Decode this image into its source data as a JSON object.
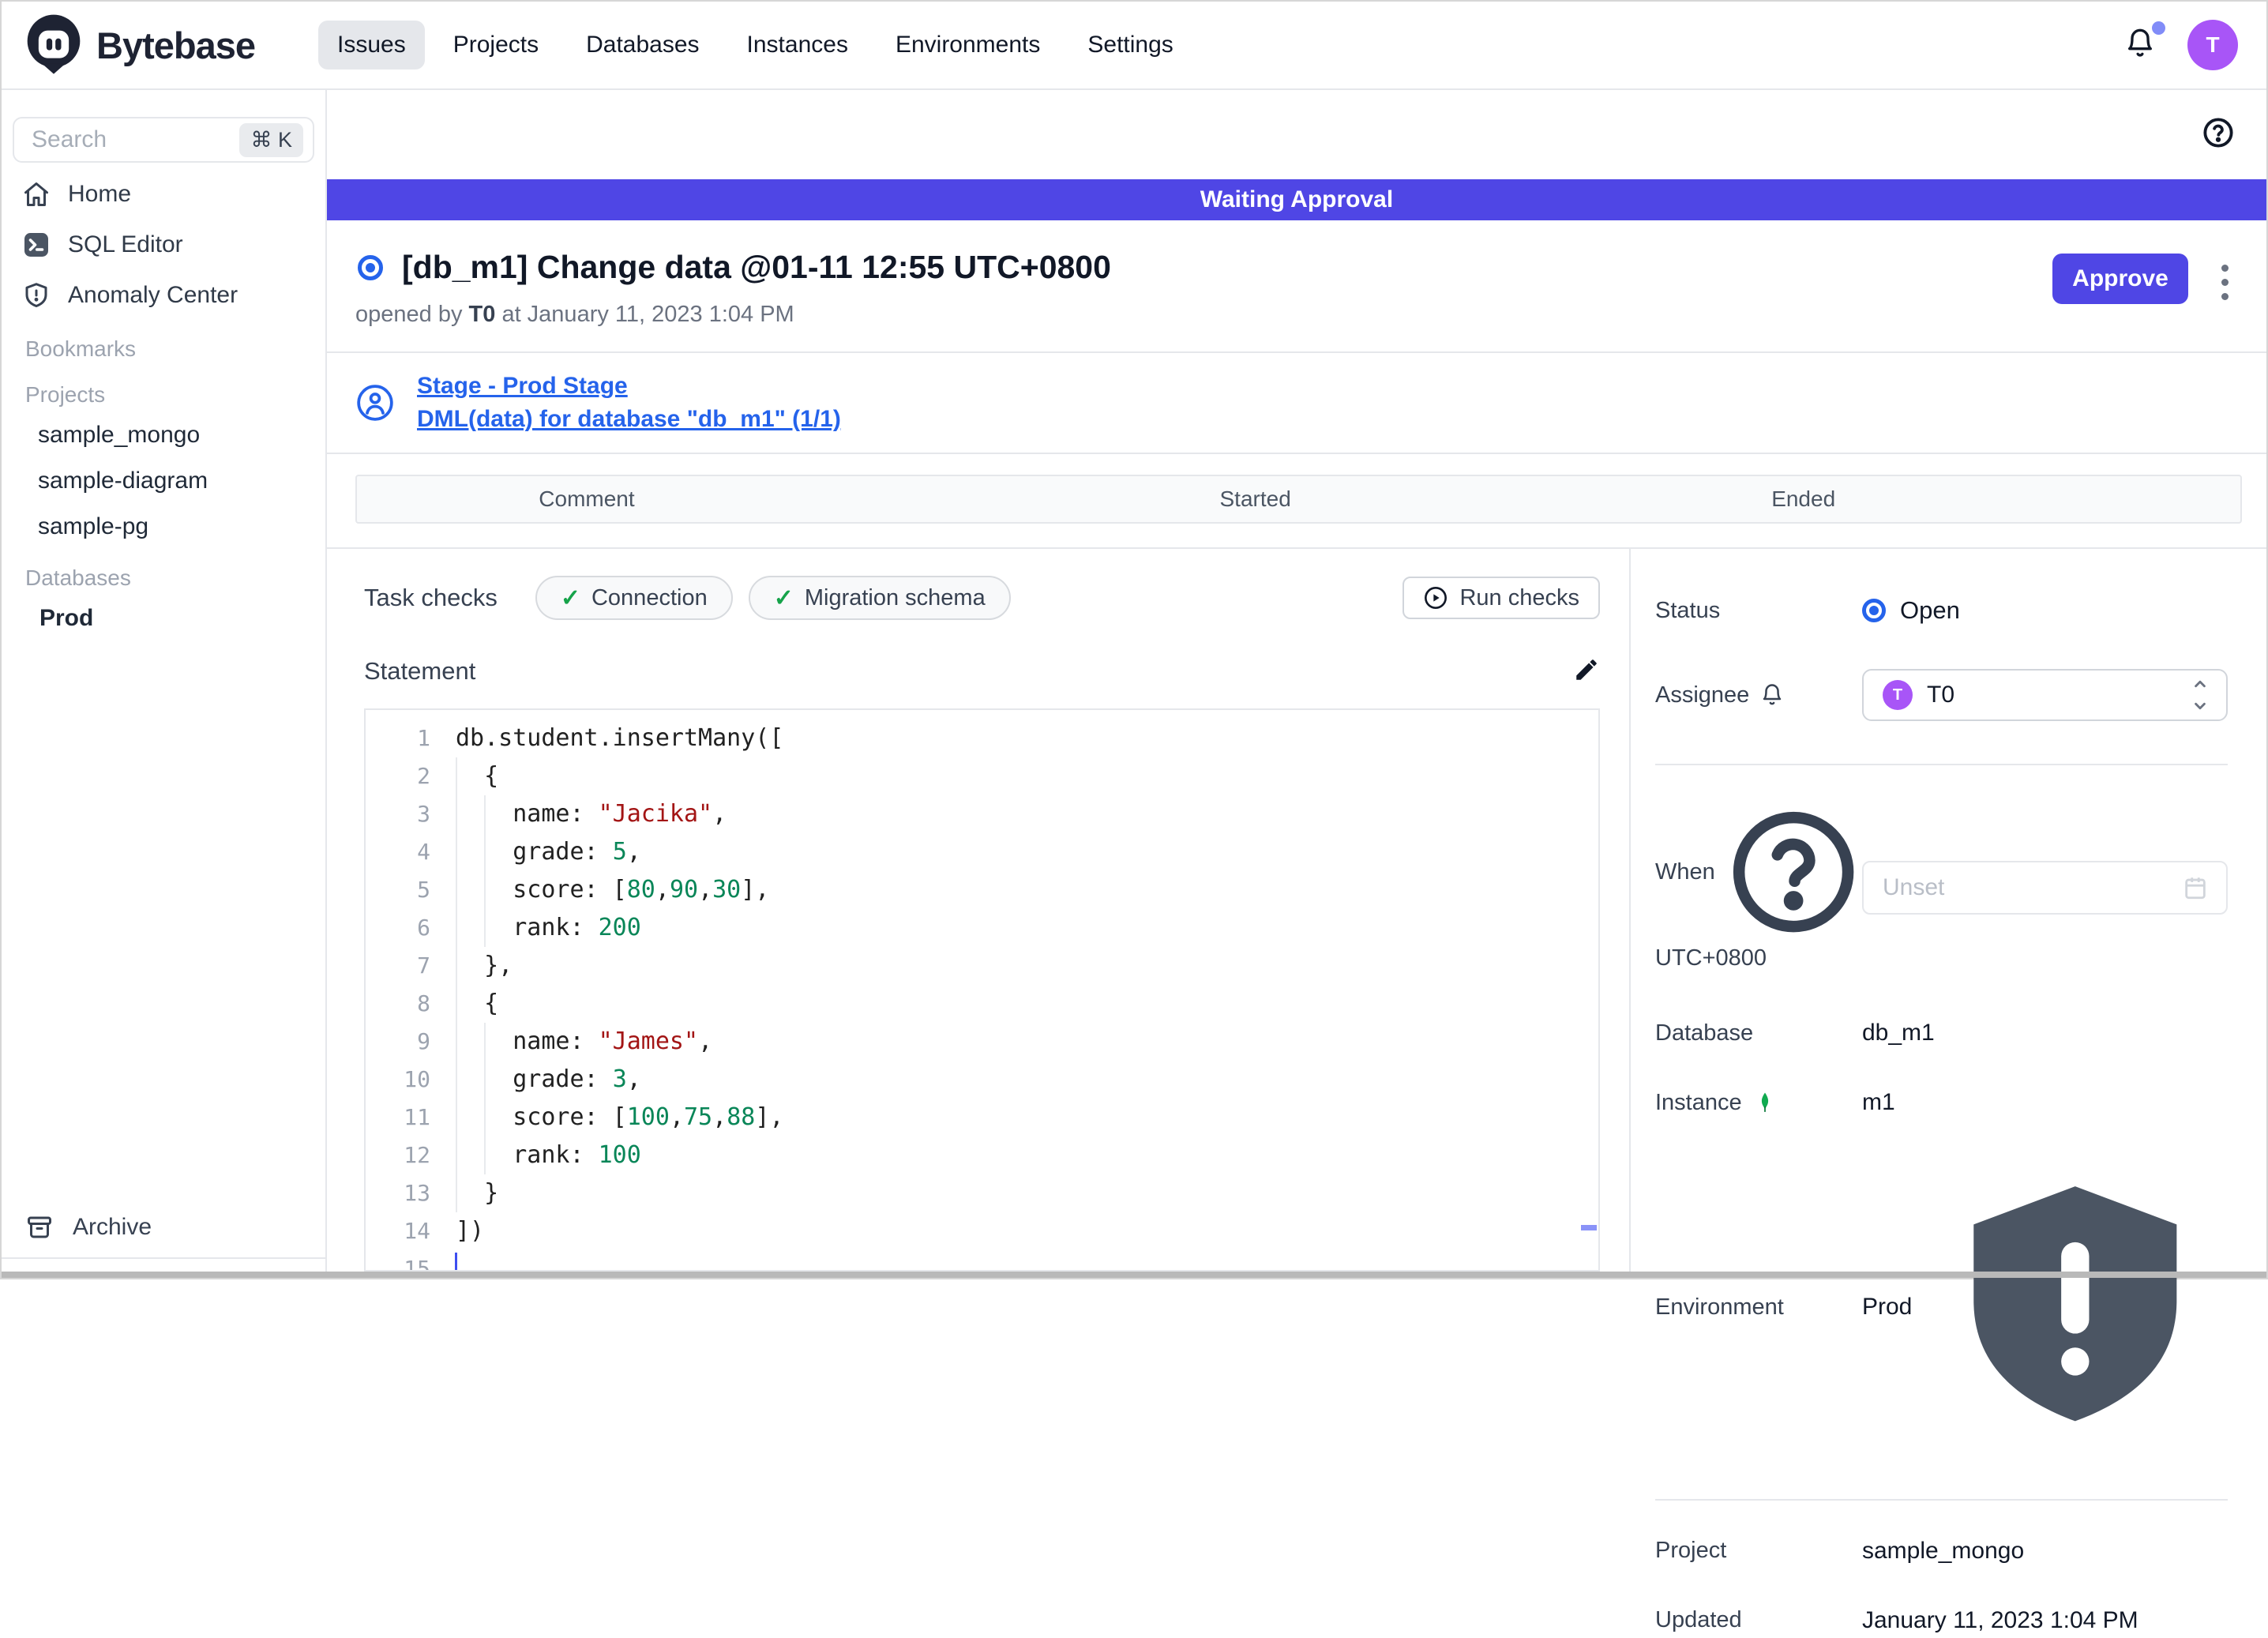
{
  "colors": {
    "accent_indigo": "#4f46e5",
    "link_blue": "#2563eb",
    "status_blue": "#2563eb",
    "avatar_purple": "#a855f7",
    "check_green": "#16a34a",
    "mongo_green": "#10aa50",
    "notification_dot": "#818cf8"
  },
  "header": {
    "brand": "Bytebase",
    "nav": [
      {
        "label": "Issues",
        "active": true
      },
      {
        "label": "Projects",
        "active": false
      },
      {
        "label": "Databases",
        "active": false
      },
      {
        "label": "Instances",
        "active": false
      },
      {
        "label": "Environments",
        "active": false
      },
      {
        "label": "Settings",
        "active": false
      }
    ],
    "avatar_letter": "T"
  },
  "sidebar": {
    "search_placeholder": "Search",
    "search_shortcut": "⌘ K",
    "home_label": "Home",
    "sql_editor_label": "SQL Editor",
    "anomaly_label": "Anomaly Center",
    "bookmarks_header": "Bookmarks",
    "projects_header": "Projects",
    "projects": [
      "sample_mongo",
      "sample-diagram",
      "sample-pg"
    ],
    "databases_header": "Databases",
    "databases": [
      "Prod"
    ],
    "archive_label": "Archive"
  },
  "banner": {
    "text": "Waiting Approval"
  },
  "issue": {
    "title": "[db_m1] Change data @01-11 12:55 UTC+0800",
    "opened_prefix": "opened by",
    "opener": "T0",
    "opened_suffix": "at January 11, 2023 1:04 PM",
    "approve_label": "Approve"
  },
  "stage": {
    "stage_link": "Stage - Prod Stage",
    "task_link": "DML(data) for database \"db_m1\" (1/1)"
  },
  "task_table": {
    "columns": [
      "Comment",
      "Started",
      "Ended"
    ]
  },
  "task_checks": {
    "label": "Task checks",
    "checks": [
      "Connection",
      "Migration schema"
    ],
    "run_label": "Run checks"
  },
  "statement": {
    "label": "Statement"
  },
  "editor": {
    "lines": [
      {
        "segments": [
          {
            "t": "db.student.insertMany([",
            "c": "plain"
          }
        ]
      },
      {
        "segments": [
          {
            "t": "  {",
            "c": "plain"
          }
        ]
      },
      {
        "segments": [
          {
            "t": "    name: ",
            "c": "plain"
          },
          {
            "t": "\"Jacika\"",
            "c": "string"
          },
          {
            "t": ",",
            "c": "plain"
          }
        ]
      },
      {
        "segments": [
          {
            "t": "    grade: ",
            "c": "plain"
          },
          {
            "t": "5",
            "c": "number"
          },
          {
            "t": ",",
            "c": "plain"
          }
        ]
      },
      {
        "segments": [
          {
            "t": "    score: [",
            "c": "plain"
          },
          {
            "t": "80",
            "c": "number"
          },
          {
            "t": ",",
            "c": "plain"
          },
          {
            "t": "90",
            "c": "number"
          },
          {
            "t": ",",
            "c": "plain"
          },
          {
            "t": "30",
            "c": "number"
          },
          {
            "t": "],",
            "c": "plain"
          }
        ]
      },
      {
        "segments": [
          {
            "t": "    rank: ",
            "c": "plain"
          },
          {
            "t": "200",
            "c": "number"
          }
        ]
      },
      {
        "segments": [
          {
            "t": "  },",
            "c": "plain"
          }
        ]
      },
      {
        "segments": [
          {
            "t": "  {",
            "c": "plain"
          }
        ]
      },
      {
        "segments": [
          {
            "t": "    name: ",
            "c": "plain"
          },
          {
            "t": "\"James\"",
            "c": "string"
          },
          {
            "t": ",",
            "c": "plain"
          }
        ]
      },
      {
        "segments": [
          {
            "t": "    grade: ",
            "c": "plain"
          },
          {
            "t": "3",
            "c": "number"
          },
          {
            "t": ",",
            "c": "plain"
          }
        ]
      },
      {
        "segments": [
          {
            "t": "    score: [",
            "c": "plain"
          },
          {
            "t": "100",
            "c": "number"
          },
          {
            "t": ",",
            "c": "plain"
          },
          {
            "t": "75",
            "c": "number"
          },
          {
            "t": ",",
            "c": "plain"
          },
          {
            "t": "88",
            "c": "number"
          },
          {
            "t": "],",
            "c": "plain"
          }
        ]
      },
      {
        "segments": [
          {
            "t": "    rank: ",
            "c": "plain"
          },
          {
            "t": "100",
            "c": "number"
          }
        ]
      },
      {
        "segments": [
          {
            "t": "  }",
            "c": "plain"
          }
        ]
      },
      {
        "segments": [
          {
            "t": "])",
            "c": "plain"
          }
        ]
      },
      {
        "segments": [],
        "cursor": true
      }
    ]
  },
  "details": {
    "status_label": "Status",
    "status_value": "Open",
    "assignee_label": "Assignee",
    "assignee_value": "T0",
    "assignee_avatar_letter": "T",
    "when_label": "When",
    "when_tz": "UTC+0800",
    "when_placeholder": "Unset",
    "database_label": "Database",
    "database_value": "db_m1",
    "instance_label": "Instance",
    "instance_value": "m1",
    "environment_label": "Environment",
    "environment_value": "Prod",
    "project_label": "Project",
    "project_value": "sample_mongo",
    "updated_label": "Updated",
    "updated_value": "January 11, 2023 1:04 PM"
  }
}
